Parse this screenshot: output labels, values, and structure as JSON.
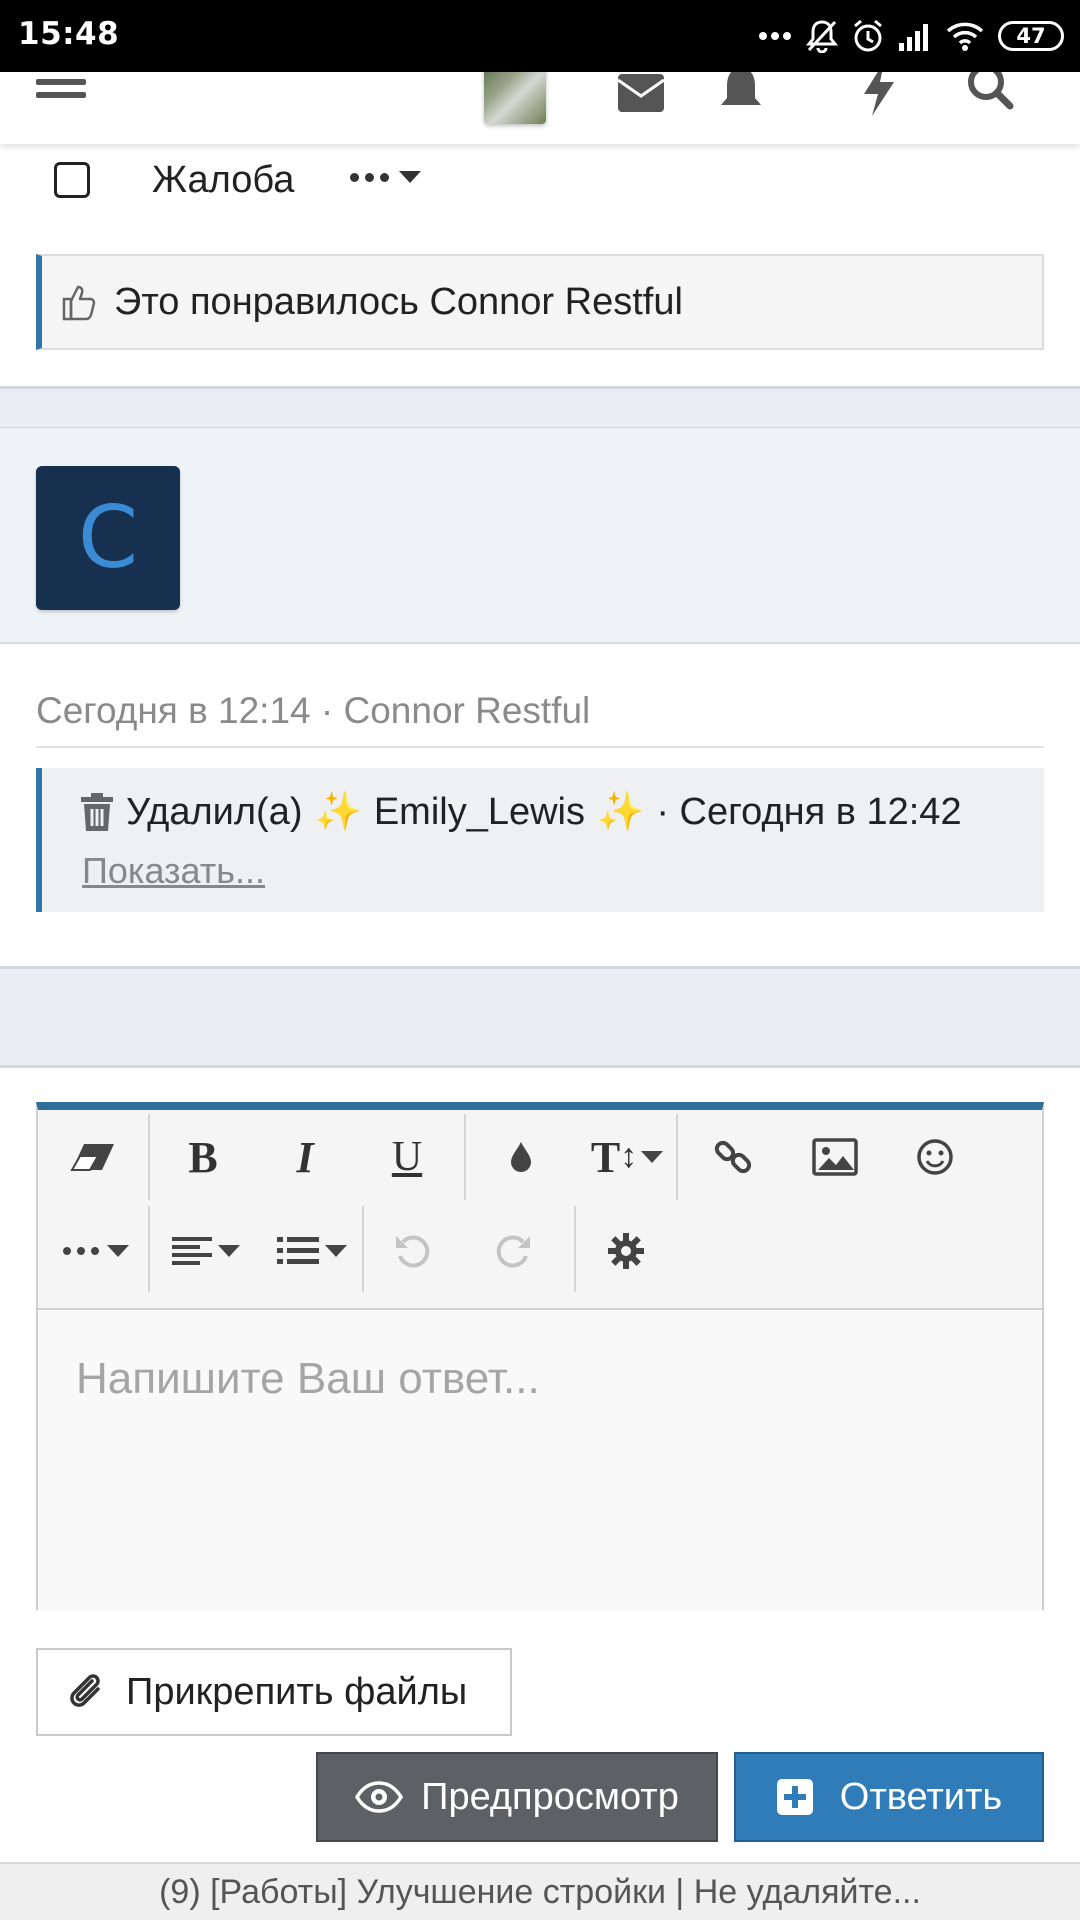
{
  "status_bar": {
    "time": "15:48",
    "battery": "47",
    "icons": [
      "more-dots-icon",
      "silent-bell-icon",
      "alarm-icon",
      "signal-icon",
      "wifi-icon",
      "battery-icon"
    ]
  },
  "top_nav": {
    "icons": [
      "menu-icon",
      "user-avatar",
      "mail-icon",
      "bell-icon",
      "bolt-icon",
      "search-icon"
    ],
    "notification_accent": "#e53935"
  },
  "post_actions": {
    "report_label": "Жалоба"
  },
  "likes": {
    "text": "Это понравилось Connor Restful"
  },
  "message": {
    "avatar_letter": "C",
    "meta": "Сегодня в 12:14 · Connor Restful",
    "deleted_by_label": "Удалил(а)",
    "deleted_by_user": "Emily_Lewis",
    "deleted_time": "· Сегодня в 12:42",
    "show_link": "Показать..."
  },
  "editor": {
    "placeholder": "Напишите Ваш ответ...",
    "toolbar_row1": [
      "eraser-icon",
      "bold-icon",
      "italic-icon",
      "underline-icon",
      "color-drop-icon",
      "text-size-icon",
      "link-icon",
      "image-icon",
      "smiley-icon"
    ],
    "toolbar_row2": [
      "more-options-icon",
      "align-icon",
      "list-icon",
      "undo-icon",
      "redo-icon",
      "settings-gear-icon"
    ]
  },
  "buttons": {
    "attach": "Прикрепить файлы",
    "preview": "Предпросмотр",
    "reply": "Ответить"
  },
  "footer": {
    "tab_title": "(9) [Работы] Улучшение стройки | Не удаляйте..."
  },
  "colors": {
    "accent_blue": "#2f77a8",
    "reply_blue": "#2f7cb8",
    "avatar_bg": "#17304f",
    "sparkle": "#f2a81d"
  }
}
